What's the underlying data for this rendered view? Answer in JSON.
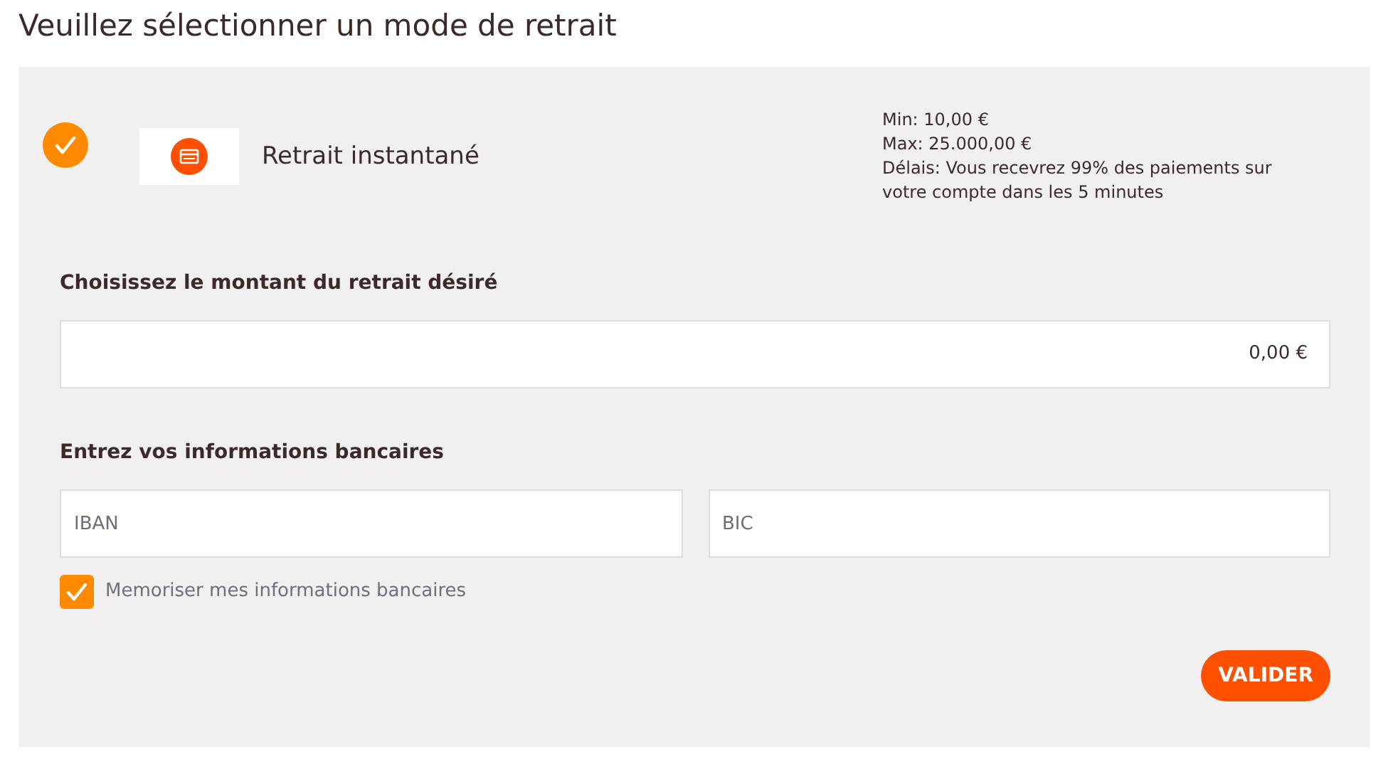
{
  "heading": "Veuillez sélectionner un mode de retrait",
  "method": {
    "selected": true,
    "name": "Retrait instantané",
    "info": [
      "Min: 10,00 €",
      "Max: 25.000,00 €",
      "Délais: Vous recevrez 99% des paiements sur votre compte dans les 5 minutes"
    ]
  },
  "amount": {
    "label": "Choisissez le montant du retrait désiré",
    "value": "0,00 €"
  },
  "bank": {
    "label": "Entrez vos informations bancaires",
    "fields": [
      {
        "placeholder": "IBAN"
      },
      {
        "placeholder": "BIC"
      }
    ],
    "remember": {
      "label": "Memoriser mes informations bancaires",
      "checked": true
    }
  },
  "submit": "VALIDER"
}
